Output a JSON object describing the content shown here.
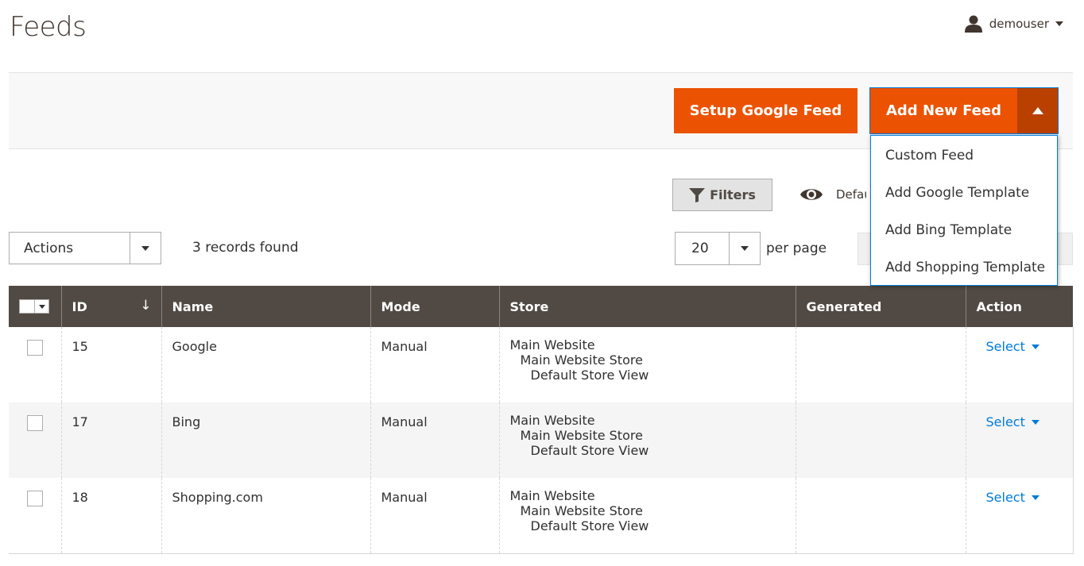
{
  "page": {
    "title": "Feeds"
  },
  "user": {
    "name": "demouser",
    "icon": "user-icon"
  },
  "toolbar": {
    "setup_label": "Setup Google Feed",
    "add_label": "Add New Feed",
    "dropdown_items": [
      "Custom Feed",
      "Add Google Template",
      "Add Bing Template",
      "Add Shopping Template"
    ]
  },
  "grid_controls": {
    "filters_label": "Filters",
    "view_label": "Default View",
    "actions_label": "Actions",
    "records_found": "3 records found",
    "per_page_value": "20",
    "per_page_label": "per page"
  },
  "table": {
    "headers": {
      "id": "ID",
      "name": "Name",
      "mode": "Mode",
      "store": "Store",
      "generated": "Generated",
      "action": "Action"
    },
    "sort_indicator": "↓",
    "rows": [
      {
        "id": "15",
        "name": "Google",
        "mode": "Manual",
        "store": [
          "Main Website",
          "Main Website Store",
          "Default Store View"
        ],
        "generated": "",
        "action": "Select"
      },
      {
        "id": "17",
        "name": "Bing",
        "mode": "Manual",
        "store": [
          "Main Website",
          "Main Website Store",
          "Default Store View"
        ],
        "generated": "",
        "action": "Select"
      },
      {
        "id": "18",
        "name": "Shopping.com",
        "mode": "Manual",
        "store": [
          "Main Website",
          "Main Website Store",
          "Default Store View"
        ],
        "generated": "",
        "action": "Select"
      }
    ]
  },
  "colors": {
    "primary": "#eb5202",
    "primary_dark": "#ba4000",
    "header_bg": "#514943",
    "link": "#007bdb"
  }
}
